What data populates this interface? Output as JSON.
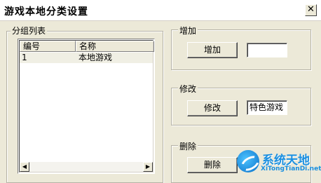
{
  "window": {
    "title": "游戏本地分类设置",
    "close_label": "✕"
  },
  "group_list": {
    "label": "分组列表",
    "columns": [
      "编号",
      "名称"
    ],
    "rows": [
      {
        "id": "1",
        "name": "本地游戏"
      }
    ]
  },
  "add": {
    "label": "增加",
    "button": "增加",
    "value": ""
  },
  "modify": {
    "label": "修改",
    "button": "修改",
    "value": "特色游戏"
  },
  "delete": {
    "label": "删除",
    "button": "删除"
  },
  "watermark": {
    "brand": "系统天地",
    "url": "XiTongTianDi.net"
  },
  "colors": {
    "window_bg": "#ece9d8",
    "logo_blue": "#1a8fe0"
  }
}
